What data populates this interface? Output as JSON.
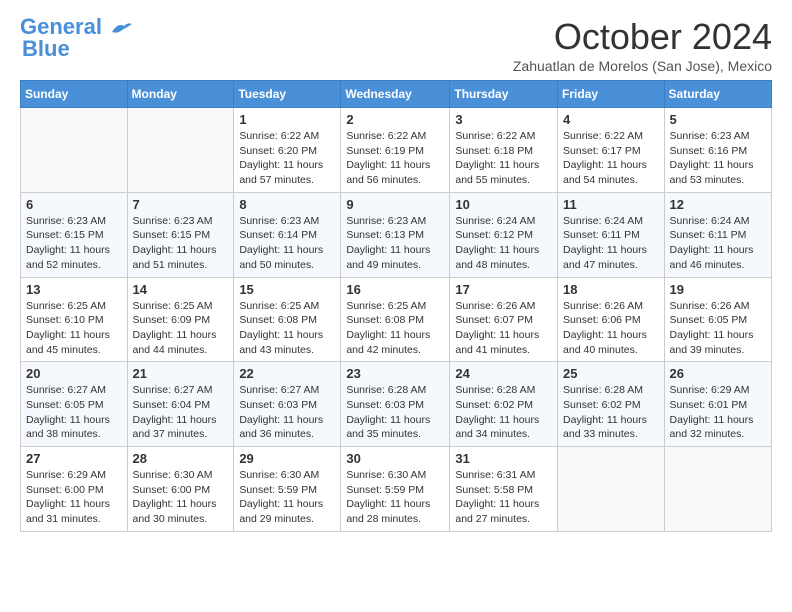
{
  "logo": {
    "line1": "General",
    "line2": "Blue"
  },
  "title": "October 2024",
  "subtitle": "Zahuatlan de Morelos (San Jose), Mexico",
  "days_of_week": [
    "Sunday",
    "Monday",
    "Tuesday",
    "Wednesday",
    "Thursday",
    "Friday",
    "Saturday"
  ],
  "weeks": [
    [
      {
        "day": "",
        "sunrise": "",
        "sunset": "",
        "daylight": ""
      },
      {
        "day": "",
        "sunrise": "",
        "sunset": "",
        "daylight": ""
      },
      {
        "day": "1",
        "sunrise": "Sunrise: 6:22 AM",
        "sunset": "Sunset: 6:20 PM",
        "daylight": "Daylight: 11 hours and 57 minutes."
      },
      {
        "day": "2",
        "sunrise": "Sunrise: 6:22 AM",
        "sunset": "Sunset: 6:19 PM",
        "daylight": "Daylight: 11 hours and 56 minutes."
      },
      {
        "day": "3",
        "sunrise": "Sunrise: 6:22 AM",
        "sunset": "Sunset: 6:18 PM",
        "daylight": "Daylight: 11 hours and 55 minutes."
      },
      {
        "day": "4",
        "sunrise": "Sunrise: 6:22 AM",
        "sunset": "Sunset: 6:17 PM",
        "daylight": "Daylight: 11 hours and 54 minutes."
      },
      {
        "day": "5",
        "sunrise": "Sunrise: 6:23 AM",
        "sunset": "Sunset: 6:16 PM",
        "daylight": "Daylight: 11 hours and 53 minutes."
      }
    ],
    [
      {
        "day": "6",
        "sunrise": "Sunrise: 6:23 AM",
        "sunset": "Sunset: 6:15 PM",
        "daylight": "Daylight: 11 hours and 52 minutes."
      },
      {
        "day": "7",
        "sunrise": "Sunrise: 6:23 AM",
        "sunset": "Sunset: 6:15 PM",
        "daylight": "Daylight: 11 hours and 51 minutes."
      },
      {
        "day": "8",
        "sunrise": "Sunrise: 6:23 AM",
        "sunset": "Sunset: 6:14 PM",
        "daylight": "Daylight: 11 hours and 50 minutes."
      },
      {
        "day": "9",
        "sunrise": "Sunrise: 6:23 AM",
        "sunset": "Sunset: 6:13 PM",
        "daylight": "Daylight: 11 hours and 49 minutes."
      },
      {
        "day": "10",
        "sunrise": "Sunrise: 6:24 AM",
        "sunset": "Sunset: 6:12 PM",
        "daylight": "Daylight: 11 hours and 48 minutes."
      },
      {
        "day": "11",
        "sunrise": "Sunrise: 6:24 AM",
        "sunset": "Sunset: 6:11 PM",
        "daylight": "Daylight: 11 hours and 47 minutes."
      },
      {
        "day": "12",
        "sunrise": "Sunrise: 6:24 AM",
        "sunset": "Sunset: 6:11 PM",
        "daylight": "Daylight: 11 hours and 46 minutes."
      }
    ],
    [
      {
        "day": "13",
        "sunrise": "Sunrise: 6:25 AM",
        "sunset": "Sunset: 6:10 PM",
        "daylight": "Daylight: 11 hours and 45 minutes."
      },
      {
        "day": "14",
        "sunrise": "Sunrise: 6:25 AM",
        "sunset": "Sunset: 6:09 PM",
        "daylight": "Daylight: 11 hours and 44 minutes."
      },
      {
        "day": "15",
        "sunrise": "Sunrise: 6:25 AM",
        "sunset": "Sunset: 6:08 PM",
        "daylight": "Daylight: 11 hours and 43 minutes."
      },
      {
        "day": "16",
        "sunrise": "Sunrise: 6:25 AM",
        "sunset": "Sunset: 6:08 PM",
        "daylight": "Daylight: 11 hours and 42 minutes."
      },
      {
        "day": "17",
        "sunrise": "Sunrise: 6:26 AM",
        "sunset": "Sunset: 6:07 PM",
        "daylight": "Daylight: 11 hours and 41 minutes."
      },
      {
        "day": "18",
        "sunrise": "Sunrise: 6:26 AM",
        "sunset": "Sunset: 6:06 PM",
        "daylight": "Daylight: 11 hours and 40 minutes."
      },
      {
        "day": "19",
        "sunrise": "Sunrise: 6:26 AM",
        "sunset": "Sunset: 6:05 PM",
        "daylight": "Daylight: 11 hours and 39 minutes."
      }
    ],
    [
      {
        "day": "20",
        "sunrise": "Sunrise: 6:27 AM",
        "sunset": "Sunset: 6:05 PM",
        "daylight": "Daylight: 11 hours and 38 minutes."
      },
      {
        "day": "21",
        "sunrise": "Sunrise: 6:27 AM",
        "sunset": "Sunset: 6:04 PM",
        "daylight": "Daylight: 11 hours and 37 minutes."
      },
      {
        "day": "22",
        "sunrise": "Sunrise: 6:27 AM",
        "sunset": "Sunset: 6:03 PM",
        "daylight": "Daylight: 11 hours and 36 minutes."
      },
      {
        "day": "23",
        "sunrise": "Sunrise: 6:28 AM",
        "sunset": "Sunset: 6:03 PM",
        "daylight": "Daylight: 11 hours and 35 minutes."
      },
      {
        "day": "24",
        "sunrise": "Sunrise: 6:28 AM",
        "sunset": "Sunset: 6:02 PM",
        "daylight": "Daylight: 11 hours and 34 minutes."
      },
      {
        "day": "25",
        "sunrise": "Sunrise: 6:28 AM",
        "sunset": "Sunset: 6:02 PM",
        "daylight": "Daylight: 11 hours and 33 minutes."
      },
      {
        "day": "26",
        "sunrise": "Sunrise: 6:29 AM",
        "sunset": "Sunset: 6:01 PM",
        "daylight": "Daylight: 11 hours and 32 minutes."
      }
    ],
    [
      {
        "day": "27",
        "sunrise": "Sunrise: 6:29 AM",
        "sunset": "Sunset: 6:00 PM",
        "daylight": "Daylight: 11 hours and 31 minutes."
      },
      {
        "day": "28",
        "sunrise": "Sunrise: 6:30 AM",
        "sunset": "Sunset: 6:00 PM",
        "daylight": "Daylight: 11 hours and 30 minutes."
      },
      {
        "day": "29",
        "sunrise": "Sunrise: 6:30 AM",
        "sunset": "Sunset: 5:59 PM",
        "daylight": "Daylight: 11 hours and 29 minutes."
      },
      {
        "day": "30",
        "sunrise": "Sunrise: 6:30 AM",
        "sunset": "Sunset: 5:59 PM",
        "daylight": "Daylight: 11 hours and 28 minutes."
      },
      {
        "day": "31",
        "sunrise": "Sunrise: 6:31 AM",
        "sunset": "Sunset: 5:58 PM",
        "daylight": "Daylight: 11 hours and 27 minutes."
      },
      {
        "day": "",
        "sunrise": "",
        "sunset": "",
        "daylight": ""
      },
      {
        "day": "",
        "sunrise": "",
        "sunset": "",
        "daylight": ""
      }
    ]
  ]
}
